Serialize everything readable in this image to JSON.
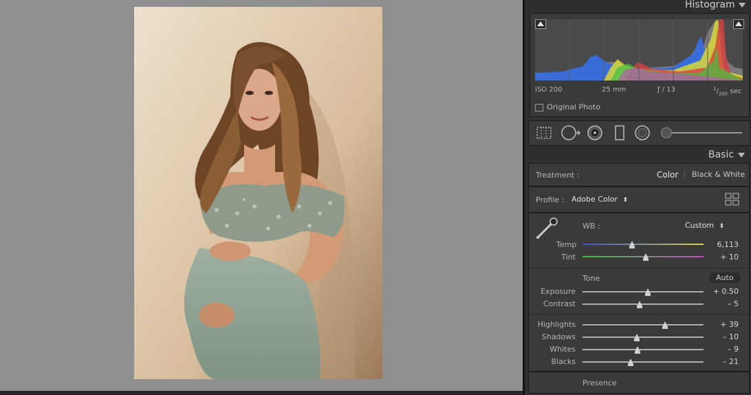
{
  "histogram": {
    "title": "Histogram",
    "iso": "ISO 200",
    "focal": "25 mm",
    "aperture": "ƒ / 13",
    "shutter_num": "1",
    "shutter_den": "200",
    "shutter_unit": "sec",
    "original_photo": "Original Photo"
  },
  "basic": {
    "title": "Basic",
    "treatment_label": "Treatment :",
    "treatment_color": "Color",
    "treatment_bw": "Black & White",
    "profile_label": "Profile :",
    "profile_value": "Adobe Color",
    "wb_label": "WB :",
    "wb_value": "Custom",
    "tone_label": "Tone",
    "auto_label": "Auto",
    "presence_label": "Presence",
    "sliders": [
      {
        "label": "Temp",
        "value": "6,113",
        "pos": 0.41
      },
      {
        "label": "Tint",
        "value": "+ 10",
        "pos": 0.52
      },
      {
        "label": "Exposure",
        "value": "+ 0.50",
        "pos": 0.54
      },
      {
        "label": "Contrast",
        "value": "– 5",
        "pos": 0.47
      },
      {
        "label": "Highlights",
        "value": "+ 39",
        "pos": 0.68
      },
      {
        "label": "Shadows",
        "value": "– 10",
        "pos": 0.45
      },
      {
        "label": "Whites",
        "value": "– 9",
        "pos": 0.455
      },
      {
        "label": "Blacks",
        "value": "– 21",
        "pos": 0.4
      }
    ]
  }
}
